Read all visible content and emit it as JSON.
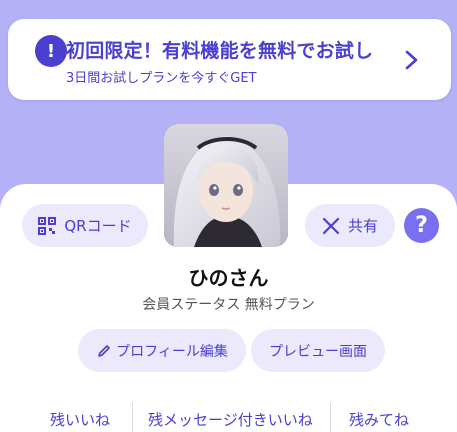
{
  "promo": {
    "title": "初回限定！有料機能を無料でお試し",
    "subtitle": "3日間お試しプランを今すぐGET",
    "icon": "exclamation-icon",
    "chevron_icon": "chevron-right-icon"
  },
  "profile": {
    "name": "ひのさん",
    "status_label": "会員ステータス",
    "status_value": "無料プラン"
  },
  "buttons": {
    "qr_label": "QRコード",
    "share_label": "共有",
    "help_label": "?",
    "edit_label": "プロフィール編集",
    "preview_label": "プレビュー画面"
  },
  "tabs": [
    {
      "label": "残いいね"
    },
    {
      "label": "残メッセージ付きいいね"
    },
    {
      "label": "残みてね"
    }
  ],
  "colors": {
    "accent": "#4a3fd1",
    "background": "#b4b1f6",
    "pill": "#ebe9fb",
    "help": "#7a6ff0"
  }
}
